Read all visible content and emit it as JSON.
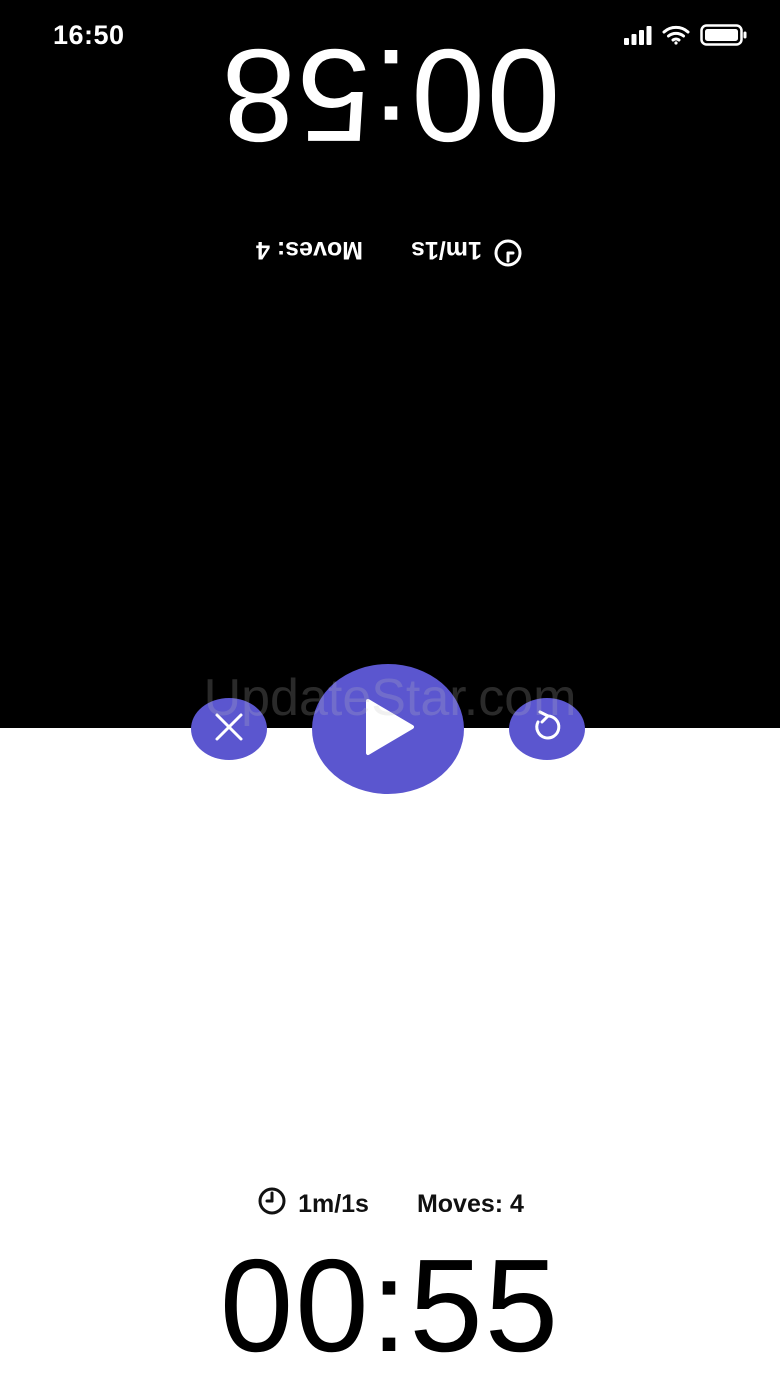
{
  "status_bar": {
    "time": "16:50",
    "icons": [
      "signal-icon",
      "wifi-icon",
      "battery-icon"
    ]
  },
  "top_player": {
    "clock": "00:58",
    "time_control": "1m/1s",
    "moves": "Moves: 4",
    "clock_icon": "clock-icon",
    "panel_color": "#000000",
    "text_color": "#ffffff"
  },
  "bottom_player": {
    "clock": "00:55",
    "time_control": "1m/1s",
    "moves": "Moves: 4",
    "clock_icon": "clock-icon",
    "panel_color": "#ffffff",
    "text_color": "#000000"
  },
  "controls": {
    "accent": "#5b56cf",
    "close_icon": "close-icon",
    "play_icon": "play-icon",
    "reset_icon": "reset-icon"
  },
  "watermark": "UpdateStar.com"
}
